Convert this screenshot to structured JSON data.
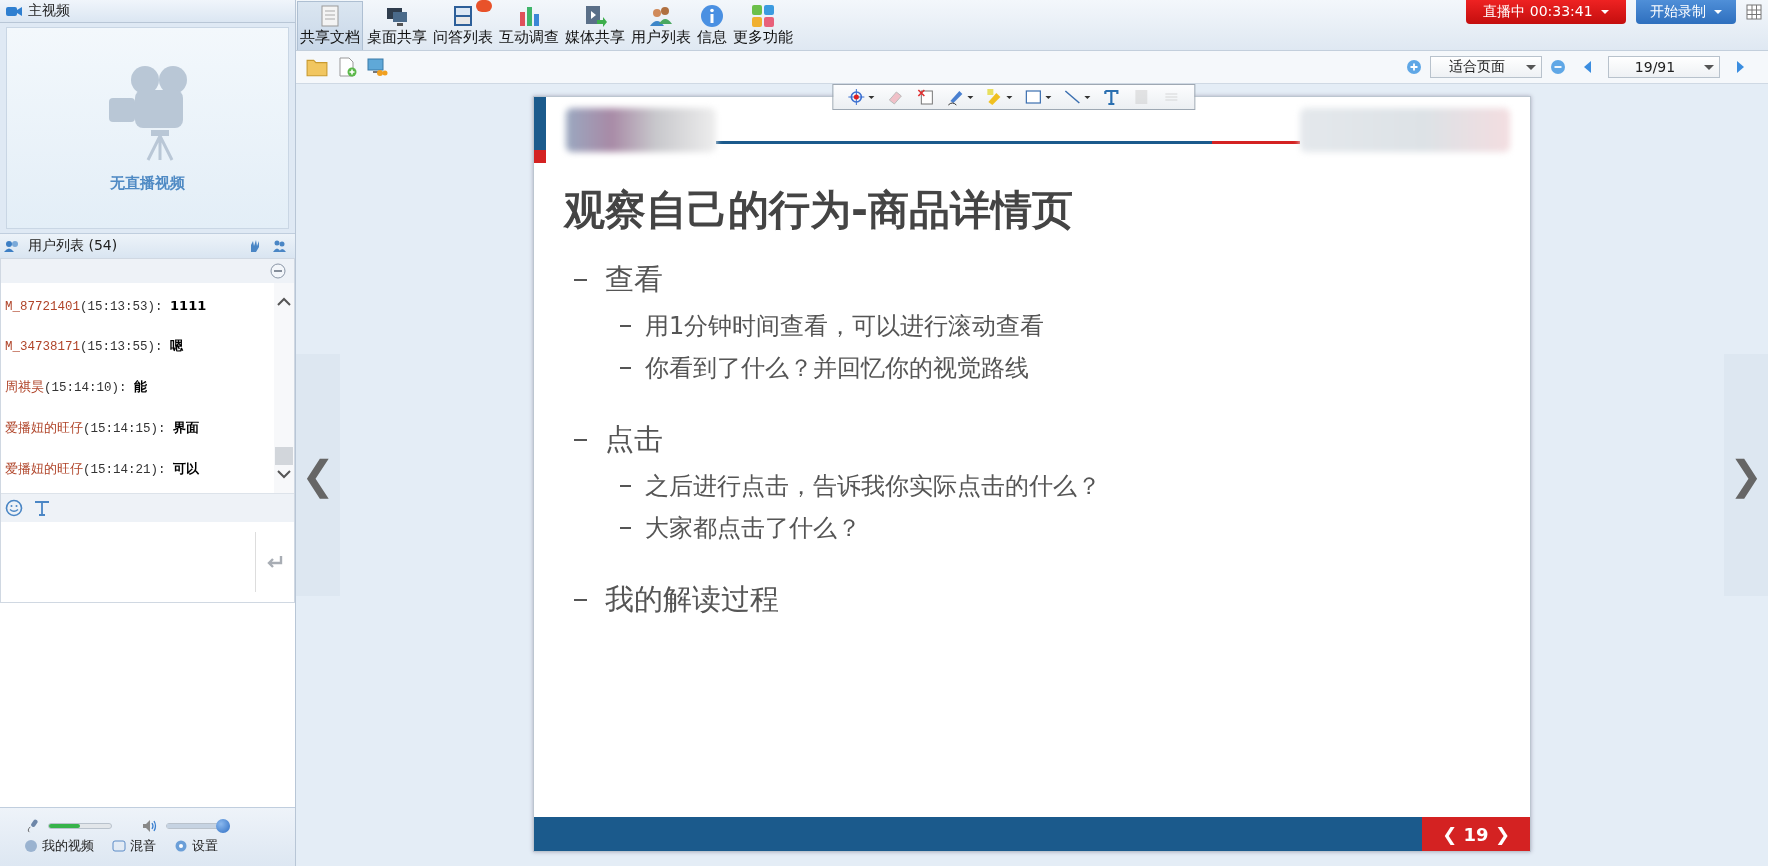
{
  "video_panel": {
    "title": "主视频",
    "message": "无直播视频"
  },
  "user_list": {
    "title": "用户列表",
    "count": "(54)"
  },
  "chat": {
    "messages": [
      {
        "user": "M_87721401",
        "time": "(15:13:53):",
        "text": "1111"
      },
      {
        "user": "M_34738171",
        "time": "(15:13:55):",
        "text": "嗯"
      },
      {
        "user": "周祺昊",
        "time": "(15:14:10):",
        "text": "能"
      },
      {
        "user": "爱播妞的旺仔",
        "time": "(15:14:15):",
        "text": "界面"
      },
      {
        "user": "爱播妞的旺仔",
        "time": "(15:14:21):",
        "text": "可以"
      }
    ]
  },
  "audio": {
    "mic": {
      "level": 0.5
    },
    "speaker": {
      "level": 1
    }
  },
  "bottom_buttons": [
    {
      "label": "我的视频",
      "kind": "video"
    },
    {
      "label": "混音",
      "kind": "mix"
    },
    {
      "label": "设置",
      "kind": "settings"
    }
  ],
  "toolbar": [
    {
      "label": "共享文档",
      "kind": "doc",
      "selected": true,
      "badge": false
    },
    {
      "label": "桌面共享",
      "kind": "desktop",
      "selected": false,
      "badge": false
    },
    {
      "label": "问答列表",
      "kind": "qa",
      "selected": false,
      "badge": true
    },
    {
      "label": "互动调查",
      "kind": "survey",
      "selected": false,
      "badge": false
    },
    {
      "label": "媒体共享",
      "kind": "media",
      "selected": false,
      "badge": false
    },
    {
      "label": "用户列表",
      "kind": "users",
      "selected": false,
      "badge": false
    },
    {
      "label": "信息",
      "kind": "info",
      "selected": false,
      "badge": false
    },
    {
      "label": "更多功能",
      "kind": "more",
      "selected": false,
      "badge": false
    }
  ],
  "live_button": "直播中 00:33:41",
  "record_button": "开始录制",
  "doc_toolbar": {
    "zoom": "适合页面",
    "page": "19/91"
  },
  "annotation_tools": [
    {
      "kind": "pointer",
      "has_menu": true,
      "disabled": false
    },
    {
      "kind": "eraser",
      "has_menu": false,
      "disabled": false
    },
    {
      "kind": "clear",
      "has_menu": false,
      "disabled": false
    },
    {
      "kind": "pen",
      "has_menu": true,
      "disabled": false
    },
    {
      "kind": "highlighter",
      "has_menu": true,
      "disabled": false
    },
    {
      "kind": "rect",
      "has_menu": true,
      "disabled": false
    },
    {
      "kind": "line",
      "has_menu": true,
      "disabled": false
    },
    {
      "kind": "text",
      "has_menu": false,
      "disabled": false
    },
    {
      "kind": "fill",
      "has_menu": false,
      "disabled": true
    },
    {
      "kind": "lines",
      "has_menu": false,
      "disabled": true
    }
  ],
  "prev_arrow": "❮",
  "next_arrow": "❯",
  "slide": {
    "title": "观察自己的行为-商品详情页",
    "bullets": [
      {
        "text": "查看",
        "children": [
          {
            "text": "用1分钟时间查看，可以进行滚动查看"
          },
          {
            "text": "你看到了什么？并回忆你的视觉路线"
          }
        ]
      },
      {
        "text": "点击",
        "children": [
          {
            "text": "之后进行点击，告诉我你实际点击的什么？"
          },
          {
            "text": "大家都点击了什么？"
          }
        ]
      },
      {
        "text": "我的解读过程"
      }
    ],
    "footer": {
      "prev": "❮",
      "page": "19",
      "next": "❯"
    }
  }
}
